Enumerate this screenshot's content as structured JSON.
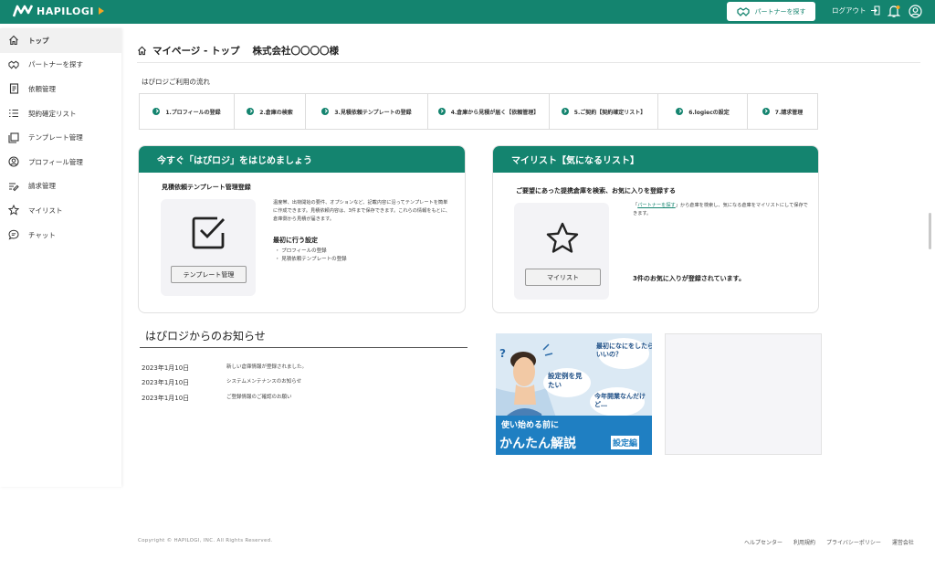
{
  "app": {
    "logo_text": "HAPILOGI"
  },
  "header": {
    "partner_search_label": "パートナーを探す",
    "logout_label": "ログアウト",
    "bell_badge_color": "#f6a623"
  },
  "sidebar": {
    "items": [
      {
        "label": "トップ",
        "icon": "home-icon"
      },
      {
        "label": "パートナーを探す",
        "icon": "handshake-icon"
      },
      {
        "label": "依頼管理",
        "icon": "document-icon"
      },
      {
        "label": "契約確定リスト",
        "icon": "list-icon"
      },
      {
        "label": "テンプレート管理",
        "icon": "template-icon"
      },
      {
        "label": "プロフィール管理",
        "icon": "profile-icon"
      },
      {
        "label": "請求管理",
        "icon": "invoice-icon"
      },
      {
        "label": "マイリスト",
        "icon": "star-icon"
      },
      {
        "label": "チャット",
        "icon": "chat-icon"
      }
    ]
  },
  "page": {
    "title": "マイページ - トップ",
    "company": "株式会社〇〇〇〇様",
    "flow_label": "はぴロジご利用の流れ",
    "steps": [
      "1.プロフィールの登録",
      "2.倉庫の検索",
      "3.見積依頼テンプレートの登録",
      "4.倉庫から見積が届く【依頼管理】",
      "5.ご契約【契約確定リスト】",
      "6.logiecの設定",
      "7.請求管理"
    ]
  },
  "start_card": {
    "header": "今すぐ「はぴロジ」をはじめましょう",
    "subtitle": "見積依頼テンプレート管理登録",
    "button": "テンプレート管理",
    "description": "温度帯、出荷開始の要件、オプションなど、記載内容に沿ってテンプレートを簡単に作成できます。見積依頼内容は、3件まで保存できます。これらの情報をもとに、倉庫側から見積が届きます。",
    "first_setup_title": "最初に行う設定",
    "first_setup_items": [
      "プロフィールの登録",
      "見積依頼テンプレートの登録"
    ]
  },
  "mylist_card": {
    "header": "マイリスト【気になるリスト】",
    "subtitle": "ご要望にあった提携倉庫を検索、お気に入りを登録する",
    "desc_link": "パートナーを探す",
    "desc_pre": "「",
    "desc_post": "」から倉庫を検索し、気になる倉庫をマイリストにして保存できます。",
    "button": "マイリスト",
    "count_text": "3件のお気に入りが登録されています。"
  },
  "news": {
    "title": "はぴロジからのお知らせ",
    "items": [
      {
        "date": "2023年1月10日",
        "text": "新しい倉庫情報が登録されました。"
      },
      {
        "date": "2023年1月10日",
        "text": "システムメンテナンスのお知らせ"
      },
      {
        "date": "2023年1月10日",
        "text": "ご登録情報のご確認のお願い"
      }
    ]
  },
  "banner": {
    "bubble1": "最初になにをしたらいいの？",
    "bubble2": "設定例を見たい",
    "bubble3": "今年開業なんだけど…",
    "caption_small": "使い始める前に",
    "caption_large": "かんたん解説",
    "tag": "設定編"
  },
  "footer": {
    "copyright": "Copyright © HAPILOGI, INC. All Rights Reserved.",
    "links": [
      "ヘルプセンター",
      "利用規約",
      "プライバシーポリシー",
      "運営会社"
    ]
  },
  "colors": {
    "brand": "#14846f",
    "accent": "#f6a623"
  }
}
